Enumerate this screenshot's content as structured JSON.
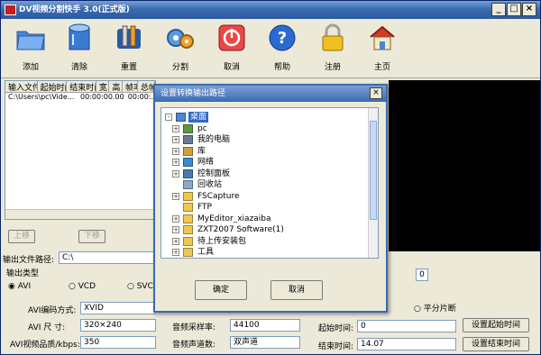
{
  "window": {
    "title": "DV视频分割快手 3.0(正式版)"
  },
  "toolbar": {
    "items": [
      {
        "label": "添加",
        "icon": "folder-open-icon"
      },
      {
        "label": "清除",
        "icon": "database-clear-icon"
      },
      {
        "label": "重置",
        "icon": "tools-reset-icon"
      },
      {
        "label": "分割",
        "icon": "split-gear-icon"
      },
      {
        "label": "取消",
        "icon": "stop-cancel-icon"
      },
      {
        "label": "帮助",
        "icon": "help-question-icon"
      },
      {
        "label": "注册",
        "icon": "lock-register-icon"
      },
      {
        "label": "主页",
        "icon": "home-icon"
      }
    ]
  },
  "file_list": {
    "headers": [
      "输入文件名",
      "起始时间",
      "结束时间",
      "宽",
      "高",
      "帧率",
      "总帧数"
    ],
    "rows": [
      [
        "C:\\Users\\pc\\Vide...",
        "00:00:00.00",
        "00:00:..."
      ]
    ]
  },
  "move_buttons": {
    "up": "上移",
    "down": "下移"
  },
  "output": {
    "path_label": "输出文件路径:",
    "path_value": "C:\\",
    "type_label": "输出类型",
    "types": [
      "AVI",
      "VCD",
      "SVCD"
    ],
    "selected_type": "AVI"
  },
  "settings": {
    "codec_label": "AVI编码方式:",
    "codec_value": "XVID",
    "size_label": "AVI  尺  寸:",
    "size_value": "320×240",
    "quality_label": "AVI视频品质/kbps:",
    "quality_value": "350",
    "samplerate_label": "音频采样率:",
    "samplerate_value": "44100",
    "channels_label": "音频声道数:",
    "channels_value": "双声道"
  },
  "preview": {
    "slider_value": "0"
  },
  "split": {
    "even_label": "平分片断",
    "start_label": "起始时间:",
    "start_value": "0",
    "end_label": "结束时间:",
    "end_value": "14.07",
    "set_start_button": "设置起始时间",
    "set_end_button": "设置结束时间"
  },
  "dialog": {
    "title": "设置转换输出路径",
    "tree": [
      {
        "label": "桌面",
        "level": 0,
        "expander": "-",
        "icon": "desktop-icon",
        "selected": true
      },
      {
        "label": "pc",
        "level": 1,
        "expander": "+",
        "icon": "user-icon"
      },
      {
        "label": "我的电脑",
        "level": 1,
        "expander": "+",
        "icon": "computer-icon"
      },
      {
        "label": "库",
        "level": 1,
        "expander": "+",
        "icon": "library-icon"
      },
      {
        "label": "网络",
        "level": 1,
        "expander": "+",
        "icon": "network-icon"
      },
      {
        "label": "控制面板",
        "level": 1,
        "expander": "+",
        "icon": "control-panel-icon"
      },
      {
        "label": "回收站",
        "level": 1,
        "expander": "",
        "icon": "recycle-bin-icon"
      },
      {
        "label": "FSCapture",
        "level": 1,
        "expander": "+",
        "icon": "folder-icon"
      },
      {
        "label": "FTP",
        "level": 1,
        "expander": "",
        "icon": "folder-icon"
      },
      {
        "label": "MyEditor_xiazaiba",
        "level": 1,
        "expander": "+",
        "icon": "folder-icon"
      },
      {
        "label": "ZXT2007 Software(1)",
        "level": 1,
        "expander": "+",
        "icon": "folder-icon"
      },
      {
        "label": "待上传安装包",
        "level": 1,
        "expander": "+",
        "icon": "folder-icon"
      },
      {
        "label": "工具",
        "level": 1,
        "expander": "+",
        "icon": "folder-icon"
      }
    ],
    "ok": "确定",
    "cancel": "取消"
  },
  "colors": {
    "title_blue": "#3a6ab0",
    "selection": "#316ac5"
  }
}
